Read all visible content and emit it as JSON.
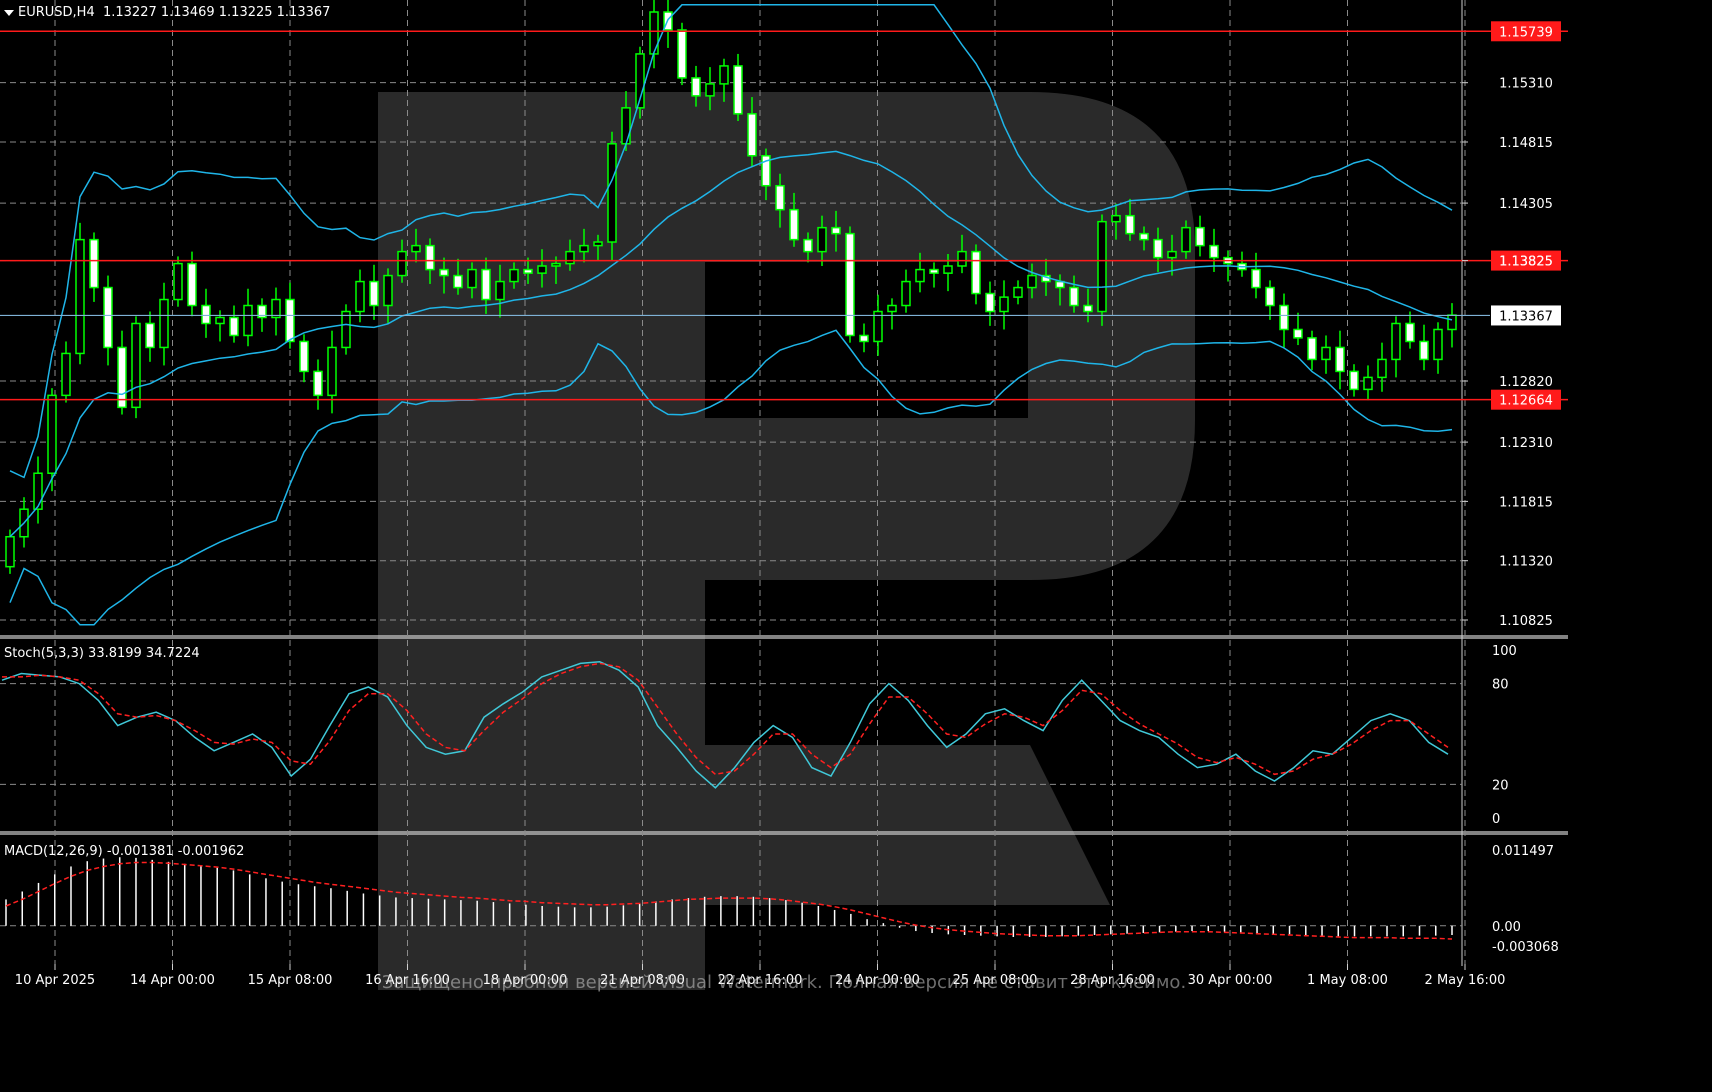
{
  "header": {
    "symbol_timeframe": "EURUSD,H4",
    "ohlc": "1.13227 1.13469 1.13225 1.13367"
  },
  "indicators": {
    "stoch_label": "Stoch(5,3,3) 33.8199 34.7224",
    "macd_label": "MACD(12,26,9) -0.001381 -0.001962"
  },
  "watermark_text": "Защищено пробной версией Visual Watermark. Полная версия не ставит это клеймо.",
  "colors": {
    "background": "#000000",
    "grid": "#8a8a8a",
    "bull_candle": "#00ff00",
    "bear_candle_body": "#ffffff",
    "bollinger": "#1fb5e8",
    "level_line": "#ff1a1a",
    "current_price_line": "#7fb2d6",
    "stoch_main": "#40c8d8",
    "stoch_signal": "#ff2020",
    "macd_hist": "#ffffff",
    "macd_signal": "#ff2020"
  },
  "chart_data": [
    {
      "type": "candlestick",
      "title": "EURUSD,H4",
      "ylim": [
        1.10825,
        1.159
      ],
      "y_ticks": [
        "1.15310",
        "1.14815",
        "1.14305",
        "1.13825",
        "1.12820",
        "1.12310",
        "1.11815",
        "1.11320",
        "1.10825"
      ],
      "y_tick_values": [
        1.1531,
        1.14815,
        1.14305,
        1.13825,
        1.1282,
        1.1231,
        1.11815,
        1.1132,
        1.10825
      ],
      "x_ticks": [
        "10 Apr 2025",
        "14 Apr 00:00",
        "15 Apr 08:00",
        "16 Apr 16:00",
        "18 Apr 00:00",
        "21 Apr 08:00",
        "22 Apr 16:00",
        "24 Apr 00:00",
        "25 Apr 08:00",
        "28 Apr 16:00",
        "30 Apr 00:00",
        "1 May 08:00",
        "2 May 16:00"
      ],
      "horizontal_levels": [
        {
          "label": "1.15739",
          "value": 1.15739
        },
        {
          "label": "1.13825",
          "value": 1.13825
        },
        {
          "label": "1.12664",
          "value": 1.12664
        }
      ],
      "current_price": {
        "label": "1.13367",
        "value": 1.13367
      },
      "candles_close": [
        1.1152,
        1.1175,
        1.1205,
        1.127,
        1.1305,
        1.14,
        1.136,
        1.131,
        1.126,
        1.133,
        1.131,
        1.135,
        1.138,
        1.1345,
        1.133,
        1.1335,
        1.132,
        1.1345,
        1.1335,
        1.135,
        1.1315,
        1.129,
        1.127,
        1.131,
        1.134,
        1.1365,
        1.1345,
        1.137,
        1.139,
        1.1395,
        1.1375,
        1.137,
        1.136,
        1.1375,
        1.135,
        1.1365,
        1.1375,
        1.1372,
        1.1378,
        1.138,
        1.139,
        1.1395,
        1.1398,
        1.148,
        1.151,
        1.1555,
        1.159,
        1.1575,
        1.1535,
        1.152,
        1.153,
        1.1545,
        1.1505,
        1.147,
        1.1445,
        1.1425,
        1.14,
        1.139,
        1.141,
        1.1405,
        1.132,
        1.1315,
        1.134,
        1.1345,
        1.1365,
        1.1375,
        1.1372,
        1.1378,
        1.139,
        1.1355,
        1.134,
        1.1352,
        1.136,
        1.137,
        1.1365,
        1.136,
        1.1345,
        1.134,
        1.1415,
        1.142,
        1.1405,
        1.14,
        1.1385,
        1.139,
        1.141,
        1.1395,
        1.1385,
        1.138,
        1.1375,
        1.136,
        1.1345,
        1.1325,
        1.1318,
        1.13,
        1.131,
        1.129,
        1.1275,
        1.1285,
        1.13,
        1.133,
        1.1315,
        1.13,
        1.1325,
        1.1337
      ],
      "series": [
        {
          "name": "Bollinger upper",
          "role": "band"
        },
        {
          "name": "Bollinger middle",
          "role": "band"
        },
        {
          "name": "Bollinger lower",
          "role": "band"
        }
      ]
    },
    {
      "type": "line",
      "title": "Stoch(5,3,3) 33.8199 34.7224",
      "ylim": [
        0,
        100
      ],
      "y_ticks": [
        "100",
        "80",
        "20",
        "0"
      ],
      "y_tick_values": [
        100,
        80,
        20,
        0
      ],
      "series": [
        {
          "name": "main",
          "values": [
            82,
            86,
            85,
            84,
            80,
            70,
            55,
            60,
            63,
            58,
            48,
            40,
            45,
            50,
            42,
            25,
            35,
            55,
            74,
            78,
            72,
            55,
            42,
            38,
            40,
            60,
            68,
            75,
            84,
            88,
            92,
            93,
            88,
            78,
            55,
            42,
            28,
            18,
            30,
            45,
            55,
            48,
            30,
            25,
            45,
            68,
            80,
            70,
            55,
            42,
            50,
            62,
            65,
            58,
            52,
            70,
            82,
            70,
            58,
            52,
            48,
            38,
            30,
            32,
            38,
            28,
            22,
            30,
            40,
            38,
            48,
            58,
            62,
            58,
            45,
            38
          ]
        },
        {
          "name": "signal",
          "values": [
            84,
            84,
            85,
            84,
            82,
            74,
            62,
            60,
            61,
            58,
            52,
            45,
            44,
            47,
            45,
            34,
            32,
            46,
            64,
            74,
            74,
            64,
            50,
            42,
            40,
            52,
            63,
            71,
            80,
            86,
            90,
            92,
            90,
            82,
            66,
            50,
            36,
            26,
            28,
            38,
            50,
            50,
            38,
            30,
            38,
            56,
            72,
            72,
            62,
            50,
            48,
            56,
            62,
            60,
            55,
            64,
            76,
            74,
            64,
            56,
            50,
            44,
            36,
            33,
            36,
            32,
            26,
            28,
            35,
            38,
            44,
            52,
            58,
            58,
            50,
            42
          ]
        }
      ]
    },
    {
      "type": "bar",
      "title": "MACD(12,26,9) -0.001381 -0.001962",
      "ylim": [
        -0.003068,
        0.011497
      ],
      "y_ticks": [
        "0.011497",
        "0.00",
        "-0.003068"
      ],
      "y_tick_values": [
        0.011497,
        0.0,
        -0.003068
      ],
      "series": [
        {
          "name": "histogram",
          "values": [
            0.004,
            0.0052,
            0.0065,
            0.0078,
            0.009,
            0.0098,
            0.0102,
            0.0104,
            0.0103,
            0.01,
            0.0097,
            0.0094,
            0.0091,
            0.0088,
            0.0084,
            0.0078,
            0.0072,
            0.0067,
            0.0063,
            0.006,
            0.0057,
            0.0053,
            0.0049,
            0.0046,
            0.0043,
            0.0042,
            0.0041,
            0.004,
            0.0039,
            0.0038,
            0.0036,
            0.0034,
            0.0032,
            0.003,
            0.0029,
            0.0028,
            0.0028,
            0.0029,
            0.0031,
            0.0034,
            0.0037,
            0.004,
            0.0042,
            0.0044,
            0.0045,
            0.0045,
            0.0044,
            0.0042,
            0.0039,
            0.0035,
            0.003,
            0.0024,
            0.0018,
            0.001,
            0.0004,
            -0.0003,
            -0.0008,
            -0.0011,
            -0.0013,
            -0.0014,
            -0.0015,
            -0.0016,
            -0.0017,
            -0.0017,
            -0.0017,
            -0.0016,
            -0.0015,
            -0.0014,
            -0.0013,
            -0.0012,
            -0.0011,
            -0.001,
            -0.0009,
            -0.0008,
            -0.0008,
            -0.0009,
            -0.001,
            -0.0011,
            -0.0012,
            -0.0013,
            -0.0014,
            -0.0015,
            -0.0016,
            -0.0016,
            -0.0016,
            -0.0016,
            -0.0016,
            -0.0015,
            -0.0015,
            -0.0014
          ]
        },
        {
          "name": "signal",
          "values": [
            0.003,
            0.004,
            0.0052,
            0.0064,
            0.0075,
            0.0084,
            0.009,
            0.0094,
            0.0096,
            0.0096,
            0.0095,
            0.0093,
            0.0091,
            0.0089,
            0.0086,
            0.0082,
            0.0078,
            0.0074,
            0.007,
            0.0066,
            0.0063,
            0.006,
            0.0057,
            0.0054,
            0.0051,
            0.0049,
            0.0047,
            0.0045,
            0.0043,
            0.0042,
            0.004,
            0.0038,
            0.0037,
            0.0035,
            0.0034,
            0.0033,
            0.0032,
            0.0032,
            0.0033,
            0.0034,
            0.0036,
            0.0038,
            0.004,
            0.0041,
            0.0042,
            0.0042,
            0.0042,
            0.0041,
            0.0039,
            0.0036,
            0.0033,
            0.0029,
            0.0024,
            0.0018,
            0.0012,
            0.0006,
            0.0001,
            -0.0003,
            -0.0006,
            -0.0008,
            -0.001,
            -0.0012,
            -0.0013,
            -0.0014,
            -0.0015,
            -0.0015,
            -0.0015,
            -0.0014,
            -0.0013,
            -0.0012,
            -0.0011,
            -0.001,
            -0.0009,
            -0.0009,
            -0.0009,
            -0.001,
            -0.0011,
            -0.0012,
            -0.0013,
            -0.0014,
            -0.0015,
            -0.0016,
            -0.0017,
            -0.0018,
            -0.0018,
            -0.0018,
            -0.0019,
            -0.0019,
            -0.0019,
            -0.002
          ]
        }
      ]
    }
  ]
}
